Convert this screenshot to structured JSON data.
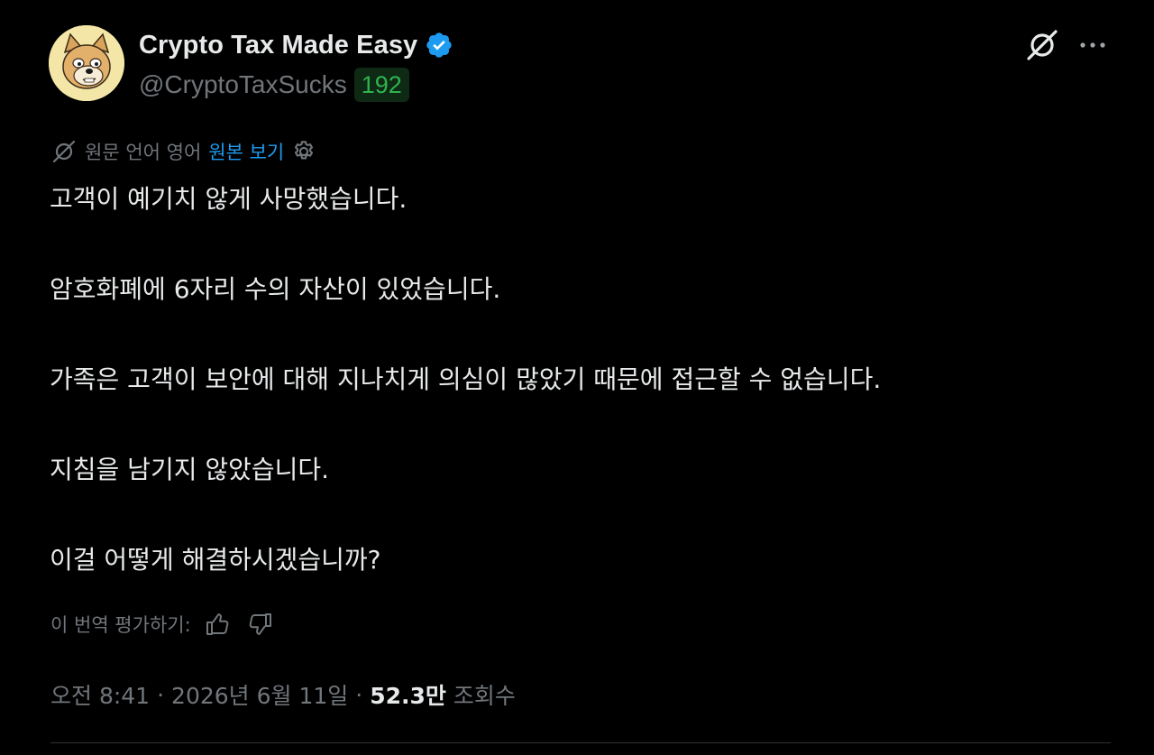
{
  "author": {
    "display_name": "Crypto Tax Made Easy",
    "handle": "@CryptoTaxSucks",
    "badge_count": "192",
    "avatar_icon": "doge-cartoon-avatar",
    "verified_icon": "verified-badge-icon"
  },
  "translation": {
    "label": "원문 언어 영어",
    "show_original": "원본 보기",
    "rate_label": "이 번역 평가하기:"
  },
  "tweet": {
    "paragraphs": [
      "고객이 예기치 않게 사망했습니다.",
      "암호화폐에 6자리 수의 자산이 있었습니다.",
      "가족은 고객이 보안에 대해 지나치게 의심이 많았기 때문에 접근할 수 없습니다.",
      "지침을 남기지 않았습니다.",
      "이걸 어떻게 해결하시겠습니까?"
    ]
  },
  "meta": {
    "time": "오전 8:41",
    "separator": "·",
    "date": "2026년 6월 11일",
    "views_count": "52.3만",
    "views_label": "조회수"
  },
  "colors": {
    "background": "#000000",
    "text_primary": "#e7e9ea",
    "text_secondary": "#71767b",
    "link": "#1d9bf0",
    "verified": "#1d9bf0",
    "badge_bg": "#0f2a14",
    "badge_text": "#2fb24e",
    "divider": "#2f3336"
  }
}
